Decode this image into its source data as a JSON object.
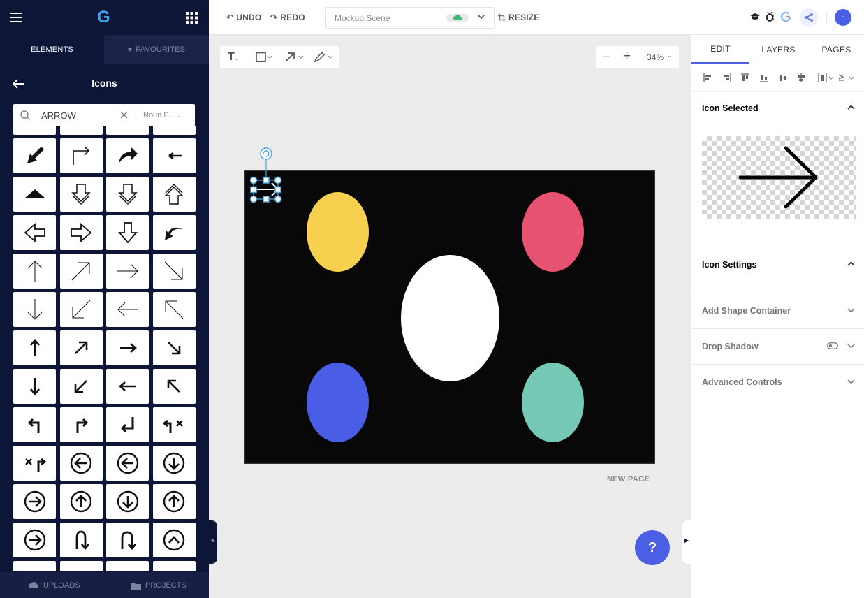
{
  "app": {
    "logo": "G",
    "menu_icon": "hamburger-icon",
    "apps_icon": "grid-icon"
  },
  "left_panel": {
    "tabs": [
      {
        "label": "ELEMENTS",
        "active": true
      },
      {
        "label": "FAVOURITES",
        "icon": "heart-icon",
        "active": false
      }
    ],
    "section_title": "Icons",
    "search": {
      "value": "ARROW",
      "source": "Noun P..."
    },
    "bottom": [
      {
        "label": "UPLOADS",
        "icon": "cloud-upload-icon"
      },
      {
        "label": "PROJECTS",
        "icon": "folder-icon"
      }
    ],
    "icons": [
      "arrow-down-left-fill-icon",
      "turn-right-arrow-icon",
      "curved-arrow-right-icon",
      "arrow-left-small-icon",
      "triangle-up-icon",
      "double-down-outline-arrow-icon",
      "double-down-outline-arrow-icon",
      "double-up-outline-arrow-icon",
      "outline-left-arrow-icon",
      "outline-right-arrow-icon",
      "outline-down-arrow-icon",
      "curved-arrow-back-icon",
      "thin-up-arrow-icon",
      "thin-up-right-arrow-icon",
      "thin-right-arrow-icon",
      "thin-down-right-arrow-icon",
      "thin-down-arrow-icon",
      "thin-down-left-arrow-icon",
      "thin-left-arrow-icon",
      "thin-up-left-arrow-icon",
      "bold-up-arrow-icon",
      "bold-up-right-arrow-icon",
      "bold-right-arrow-icon",
      "bold-down-right-arrow-icon",
      "bold-down-arrow-icon",
      "bold-down-left-arrow-icon",
      "bold-left-arrow-icon",
      "bold-up-left-arrow-icon",
      "turn-left-up-icon",
      "turn-right-up-icon",
      "return-arrow-icon",
      "no-left-turn-icon",
      "no-right-turn-icon",
      "circle-left-arrow-icon",
      "circle-left-arrow-icon",
      "circle-down-arrow-icon",
      "circle-right-arrow-icon",
      "circle-up-arrow-icon",
      "circle-down-arrow-icon",
      "circle-up-arrow-icon",
      "circle-right-arrow-icon",
      "u-turn-down-icon",
      "u-turn-down-right-icon",
      "circle-chevron-up-icon"
    ]
  },
  "toolbar": {
    "undo": "UNDO",
    "redo": "REDO",
    "scene_name": "Mockup Scene",
    "resize": "RESIZE"
  },
  "canvas": {
    "zoom": "34%",
    "new_page": "NEW PAGE",
    "help": "?",
    "shapes": [
      {
        "name": "yellow-ellipse",
        "color": "#f8d04f"
      },
      {
        "name": "red-ellipse",
        "color": "#e6526f"
      },
      {
        "name": "white-ellipse",
        "color": "#ffffff"
      },
      {
        "name": "blue-ellipse",
        "color": "#4a5de6"
      },
      {
        "name": "teal-ellipse",
        "color": "#74c8b4"
      }
    ]
  },
  "right_panel": {
    "tabs": [
      {
        "label": "EDIT",
        "active": true
      },
      {
        "label": "LAYERS",
        "active": false
      },
      {
        "label": "PAGES",
        "active": false
      }
    ],
    "sections": {
      "icon_selected": "Icon Selected",
      "icon_settings": "Icon Settings",
      "add_shape_container": "Add Shape Container",
      "drop_shadow": "Drop Shadow",
      "advanced_controls": "Advanced Controls"
    }
  },
  "colors": {
    "sidebar": "#0d1637",
    "accent": "#4a5fe6",
    "canvas_bg": "#080808"
  }
}
